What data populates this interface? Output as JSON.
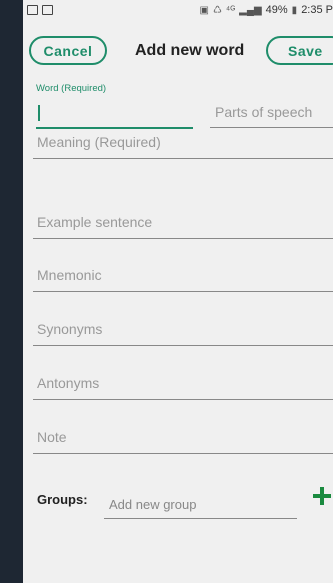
{
  "status_bar": {
    "signal_text": "⁴ᴳ",
    "battery": "49%",
    "time": "2:35 P",
    "icons": [
      "image-icon",
      "activity-icon",
      "sim-icon",
      "sync-icon",
      "signal-icon",
      "battery-icon"
    ]
  },
  "header": {
    "cancel_label": "Cancel",
    "title": "Add new word",
    "save_label": "Save"
  },
  "form": {
    "word_label": "Word (Required)",
    "word_value": "",
    "parts_of_speech_placeholder": "Parts of speech",
    "meaning_placeholder": "Meaning (Required)",
    "example_placeholder": "Example sentence",
    "mnemonic_placeholder": "Mnemonic",
    "synonyms_placeholder": "Synonyms",
    "antonyms_placeholder": "Antonyms",
    "note_placeholder": "Note"
  },
  "groups": {
    "label": "Groups:",
    "placeholder": "Add new group",
    "add_icon": "plus-icon"
  },
  "colors": {
    "accent": "#1f8d6a",
    "plus": "#1a8a3f",
    "background": "#f0f0f0",
    "frame": "#1e2733"
  }
}
